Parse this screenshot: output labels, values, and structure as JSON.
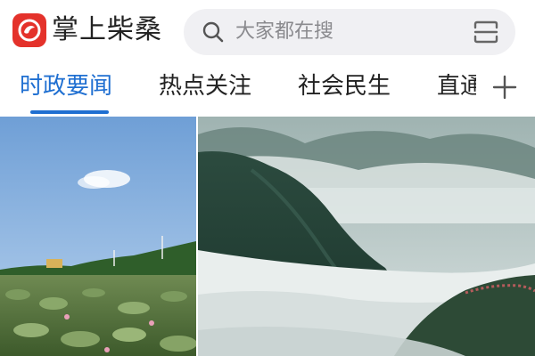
{
  "app": {
    "name": "掌上柴桑",
    "brand_color": "#e4322b",
    "logo_icon": "bird-logo-icon"
  },
  "search": {
    "placeholder": "大家都在搜",
    "icon": "search-icon",
    "scan_icon": "scan-icon"
  },
  "tabs": [
    {
      "label": "时政要闻",
      "active": true
    },
    {
      "label": "热点关注",
      "active": false
    },
    {
      "label": "社会民生",
      "active": false
    },
    {
      "label": "直通",
      "active": false
    }
  ],
  "tab_active_color": "#1f6fd1",
  "add_channel_icon": "plus-icon",
  "news_images": [
    {
      "subject": "lotus-pond-photo"
    },
    {
      "subject": "misty-mountain-photo"
    }
  ]
}
